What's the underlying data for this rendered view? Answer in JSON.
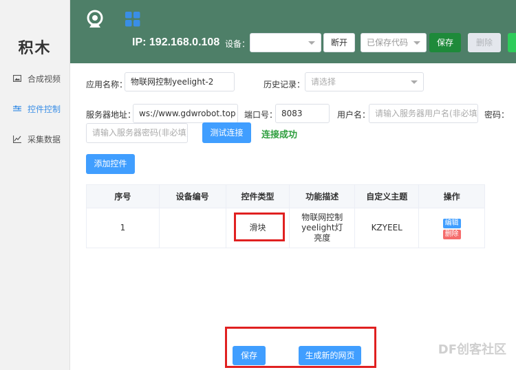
{
  "sidebar": {
    "brand": "积木",
    "items": [
      {
        "label": "合成视频",
        "icon": "image-icon"
      },
      {
        "label": "控件控制",
        "icon": "sliders-icon"
      },
      {
        "label": "采集数据",
        "icon": "chart-icon"
      }
    ],
    "active_index": 1
  },
  "header": {
    "ip": "IP: 192.168.0.108",
    "device_label": "设备：",
    "device_select_value": "",
    "disconnect_label": "断开",
    "saved_code_placeholder": "已保存代码",
    "save_label": "保存",
    "delete_label": "删除",
    "colors": {
      "bg": "#4e7f68",
      "save": "#1e8a3a"
    }
  },
  "form": {
    "app_name_label": "应用名称：",
    "app_name_value": "物联网控制yeelight-2",
    "history_label": "历史记录：",
    "history_placeholder": "请选择",
    "server_label": "服务器地址：",
    "server_value": "ws://www.gdwrobot.top",
    "port_label": "端口号：",
    "port_value": "8083",
    "username_label": "用户名：",
    "username_placeholder": "请输入服务器用户名(非必填)",
    "password_label": "密码：",
    "password_placeholder": "请输入服务器密码(非必填)",
    "test_button": "测试连接",
    "status_text": "连接成功",
    "add_control_button": "添加控件"
  },
  "table": {
    "headers": [
      "序号",
      "设备编号",
      "控件类型",
      "功能描述",
      "自定义主题",
      "操作"
    ],
    "rows": [
      {
        "index": "1",
        "device_id": "",
        "control_type": "滑块",
        "description": "物联网控制yeelight灯亮度",
        "topic": "KZYEEL",
        "edit": "编辑",
        "delete": "删除"
      }
    ]
  },
  "footer": {
    "save_button": "保存",
    "generate_button": "生成新的网页"
  },
  "watermark": "DF创客社区"
}
